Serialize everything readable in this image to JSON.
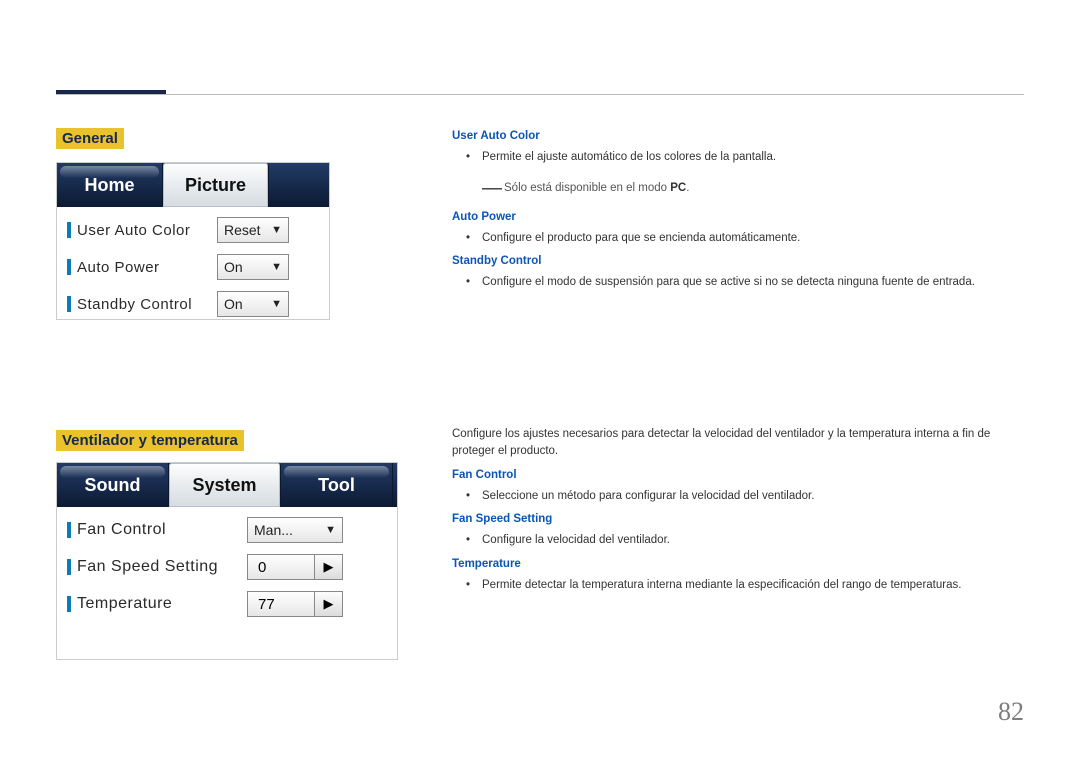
{
  "page_number": "82",
  "sections": {
    "general": {
      "heading": "General",
      "tabs": {
        "home": "Home",
        "picture": "Picture"
      },
      "rows": {
        "user_auto_color": {
          "label": "User Auto Color",
          "value": "Reset"
        },
        "auto_power": {
          "label": "Auto Power",
          "value": "On"
        },
        "standby_control": {
          "label": "Standby Control",
          "value": "On"
        }
      },
      "text": {
        "user_auto_color_head": "User Auto Color",
        "user_auto_color_desc": "Permite el ajuste automático de los colores de la pantalla.",
        "note_prefix": "Sólo está disponible en el modo ",
        "note_pc": "PC",
        "note_suffix": ".",
        "auto_power_head": "Auto Power",
        "auto_power_desc": "Configure el producto para que se encienda automáticamente.",
        "standby_control_head": "Standby Control",
        "standby_control_desc": "Configure el modo de suspensión para que se active si no se detecta ninguna fuente de entrada."
      }
    },
    "fan": {
      "heading": "Ventilador y temperatura",
      "tabs": {
        "sound": "Sound",
        "system": "System",
        "tool": "Tool"
      },
      "rows": {
        "fan_control": {
          "label": "Fan Control",
          "value": "Man..."
        },
        "fan_speed_setting": {
          "label": "Fan Speed Setting",
          "value": "0"
        },
        "temperature": {
          "label": "Temperature",
          "value": "77"
        }
      },
      "text": {
        "intro": "Configure los ajustes necesarios para detectar la velocidad del ventilador y la temperatura interna a fin de proteger el producto.",
        "fan_control_head": "Fan Control",
        "fan_control_desc": "Seleccione un método para configurar la velocidad del ventilador.",
        "fan_speed_head": "Fan Speed Setting",
        "fan_speed_desc": "Configure la velocidad del ventilador.",
        "temperature_head": "Temperature",
        "temperature_desc": "Permite detectar la temperatura interna mediante la especificación del rango de temperaturas."
      }
    }
  }
}
